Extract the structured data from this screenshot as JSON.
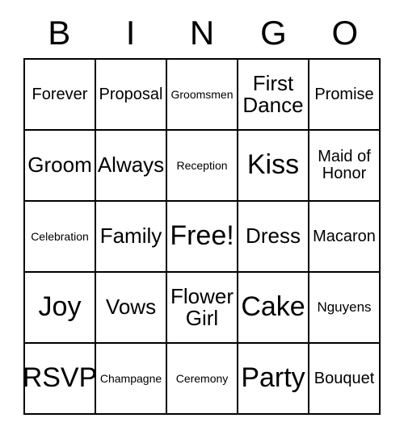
{
  "card": {
    "type": "bingo-card",
    "columns": 5,
    "rows": 5,
    "theme_colors": {
      "background": "#ffffff",
      "text": "#000000",
      "border": "#000000"
    },
    "header": {
      "letters": [
        "B",
        "I",
        "N",
        "G",
        "O"
      ]
    },
    "cells": [
      {
        "text": "Forever",
        "size": "md",
        "lines": [
          "Forever"
        ],
        "row": 1,
        "col": 1,
        "free": false
      },
      {
        "text": "Proposal",
        "size": "md",
        "lines": [
          "Proposal"
        ],
        "row": 1,
        "col": 2,
        "free": false
      },
      {
        "text": "Groomsmen",
        "size": "xs",
        "lines": [
          "Groomsmen"
        ],
        "row": 1,
        "col": 3,
        "free": false
      },
      {
        "text": "First Dance",
        "size": "lg",
        "lines": [
          "First",
          "Dance"
        ],
        "row": 1,
        "col": 4,
        "free": false
      },
      {
        "text": "Promise",
        "size": "md",
        "lines": [
          "Promise"
        ],
        "row": 1,
        "col": 5,
        "free": false
      },
      {
        "text": "Groom",
        "size": "lg",
        "lines": [
          "Groom"
        ],
        "row": 2,
        "col": 1,
        "free": false
      },
      {
        "text": "Always",
        "size": "lg",
        "lines": [
          "Always"
        ],
        "row": 2,
        "col": 2,
        "free": false
      },
      {
        "text": "Reception",
        "size": "xs",
        "lines": [
          "Reception"
        ],
        "row": 2,
        "col": 3,
        "free": false
      },
      {
        "text": "Kiss",
        "size": "xl",
        "lines": [
          "Kiss"
        ],
        "row": 2,
        "col": 4,
        "free": false
      },
      {
        "text": "Maid of Honor",
        "size": "md",
        "lines": [
          "Maid of",
          "Honor"
        ],
        "row": 2,
        "col": 5,
        "free": false
      },
      {
        "text": "Celebration",
        "size": "xs",
        "lines": [
          "Celebration"
        ],
        "row": 3,
        "col": 1,
        "free": false
      },
      {
        "text": "Family",
        "size": "lg",
        "lines": [
          "Family"
        ],
        "row": 3,
        "col": 2,
        "free": false
      },
      {
        "text": "Free!",
        "size": "xl",
        "lines": [
          "Free!"
        ],
        "row": 3,
        "col": 3,
        "free": true
      },
      {
        "text": "Dress",
        "size": "lg",
        "lines": [
          "Dress"
        ],
        "row": 3,
        "col": 4,
        "free": false
      },
      {
        "text": "Macaron",
        "size": "md",
        "lines": [
          "Macaron"
        ],
        "row": 3,
        "col": 5,
        "free": false
      },
      {
        "text": "Joy",
        "size": "xl",
        "lines": [
          "Joy"
        ],
        "row": 4,
        "col": 1,
        "free": false
      },
      {
        "text": "Vows",
        "size": "lg",
        "lines": [
          "Vows"
        ],
        "row": 4,
        "col": 2,
        "free": false
      },
      {
        "text": "Flower Girl",
        "size": "lg",
        "lines": [
          "Flower",
          "Girl"
        ],
        "row": 4,
        "col": 3,
        "free": false
      },
      {
        "text": "Cake",
        "size": "xl",
        "lines": [
          "Cake"
        ],
        "row": 4,
        "col": 4,
        "free": false
      },
      {
        "text": "Nguyens",
        "size": "sm",
        "lines": [
          "Nguyens"
        ],
        "row": 4,
        "col": 5,
        "free": false
      },
      {
        "text": "RSVP",
        "size": "xl",
        "lines": [
          "RSVP"
        ],
        "row": 5,
        "col": 1,
        "free": false
      },
      {
        "text": "Champagne",
        "size": "xs",
        "lines": [
          "Champagne"
        ],
        "row": 5,
        "col": 2,
        "free": false
      },
      {
        "text": "Ceremony",
        "size": "xs",
        "lines": [
          "Ceremony"
        ],
        "row": 5,
        "col": 3,
        "free": false
      },
      {
        "text": "Party",
        "size": "xl",
        "lines": [
          "Party"
        ],
        "row": 5,
        "col": 4,
        "free": false
      },
      {
        "text": "Bouquet",
        "size": "md",
        "lines": [
          "Bouquet"
        ],
        "row": 5,
        "col": 5,
        "free": false
      }
    ]
  }
}
